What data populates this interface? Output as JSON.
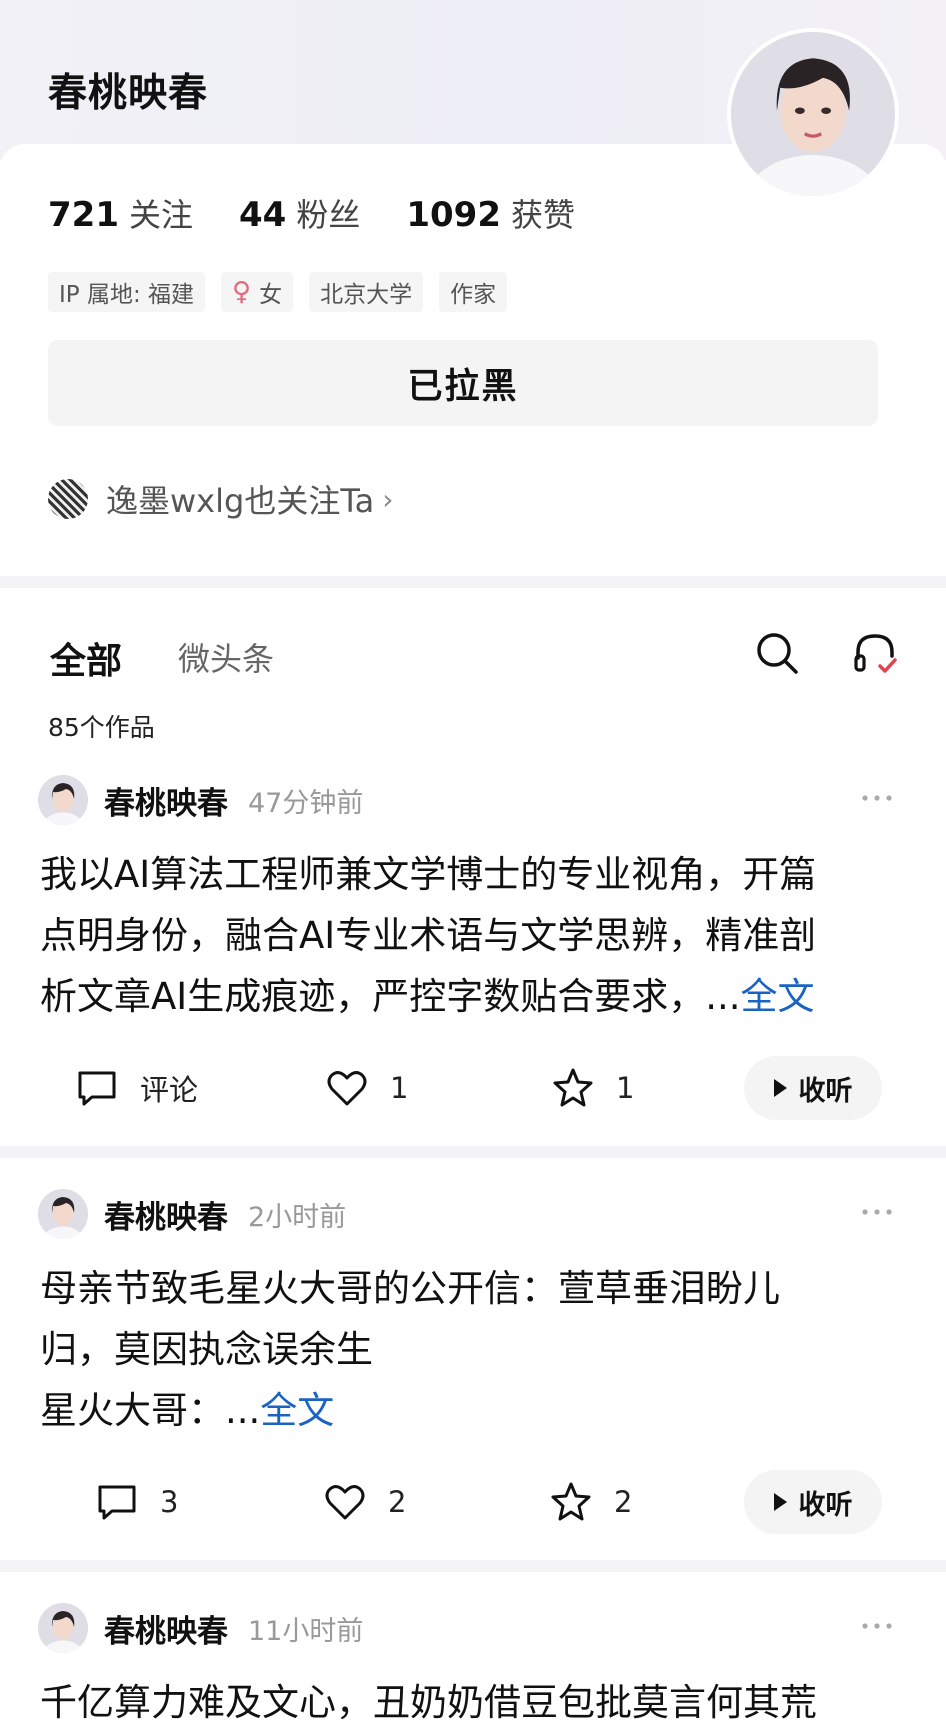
{
  "profile": {
    "name": "春桃映春",
    "stats": [
      {
        "num": "721",
        "label": "关注"
      },
      {
        "num": "44",
        "label": "粉丝"
      },
      {
        "num": "1092",
        "label": "获赞"
      }
    ],
    "tags": {
      "ip": "IP 属地: 福建",
      "gender_symbol": "♀",
      "gender": "女",
      "school": "北京大学",
      "job": "作家"
    },
    "blocked_button": "已拉黑",
    "mutual_text": "逸墨wxlg也关注Ta",
    "mutual_chevron": "›"
  },
  "tabs": {
    "all": "全部",
    "micro": "微头条",
    "works_count": "85个作品"
  },
  "posts": [
    {
      "author": "春桃映春",
      "time": "47分钟前",
      "lines": [
        "我以AI算法工程师兼文学博士的专业视角，开篇",
        "点明身份，融合AI专业术语与文学思辨，精准剖",
        "析文章AI生成痕迹，严控字数贴合要求，..."
      ],
      "full_label": "全文",
      "comment": "评论",
      "likes": "1",
      "stars": "1",
      "listen": "收听"
    },
    {
      "author": "春桃映春",
      "time": "2小时前",
      "lines": [
        "母亲节致毛星火大哥的公开信：萱草垂泪盼儿",
        "归，莫因执念误余生",
        "星火大哥：..."
      ],
      "full_label": "全文",
      "comment": "3",
      "likes": "2",
      "stars": "2",
      "listen": "收听"
    },
    {
      "author": "春桃映春",
      "time": "11小时前",
      "lines": [
        "千亿算力难及文心，丑奶奶借豆包批莫言何其荒"
      ]
    }
  ],
  "colors": {
    "accent_link": "#1a63c2",
    "female_icon": "#e06b7c",
    "headset_check": "#e0454f"
  },
  "icons": {
    "search": "search-icon",
    "headset": "headset-icon",
    "more": "more-icon",
    "comment": "comment-icon",
    "like": "heart-icon",
    "star": "star-icon",
    "play": "play-icon"
  }
}
